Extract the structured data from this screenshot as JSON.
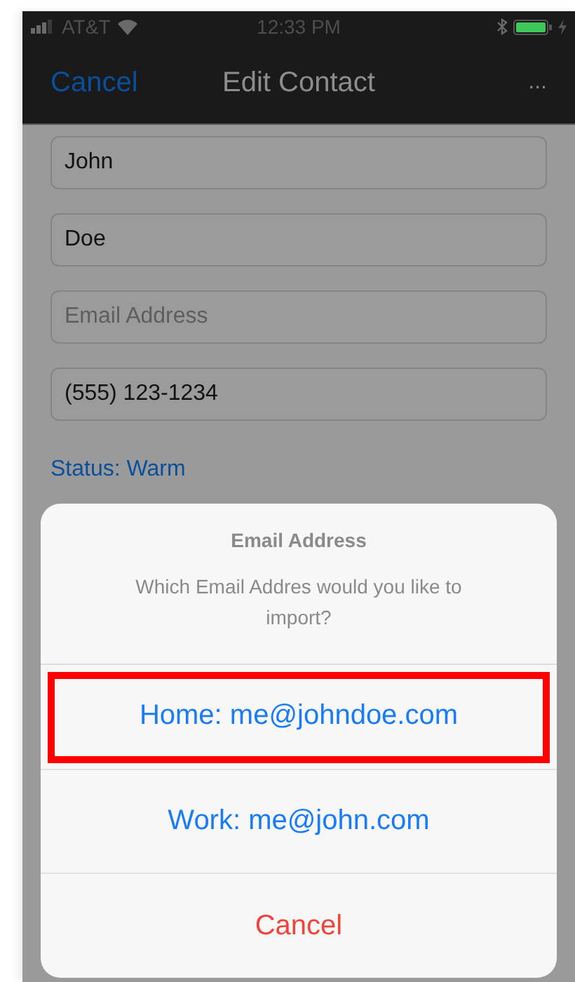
{
  "status_bar": {
    "carrier": "AT&T",
    "time": "12:33 PM"
  },
  "nav_bar": {
    "left": "Cancel",
    "title": "Edit Contact",
    "right": "..."
  },
  "fields": [
    {
      "value": "John"
    },
    {
      "value": "Doe"
    },
    {
      "placeholder": "Email Address"
    },
    {
      "value": "(555) 123-1234"
    }
  ],
  "status_link": "Status: Warm",
  "action_sheet": {
    "title": "Email Address",
    "message": "Which Email Addres would you like to import?",
    "options": [
      {
        "label": "Home: me@johndoe.com",
        "kind": "default",
        "highlighted": true
      },
      {
        "label": "Work: me@john.com",
        "kind": "default",
        "highlighted": false
      },
      {
        "label": "Cancel",
        "kind": "destructive",
        "highlighted": false
      }
    ]
  }
}
